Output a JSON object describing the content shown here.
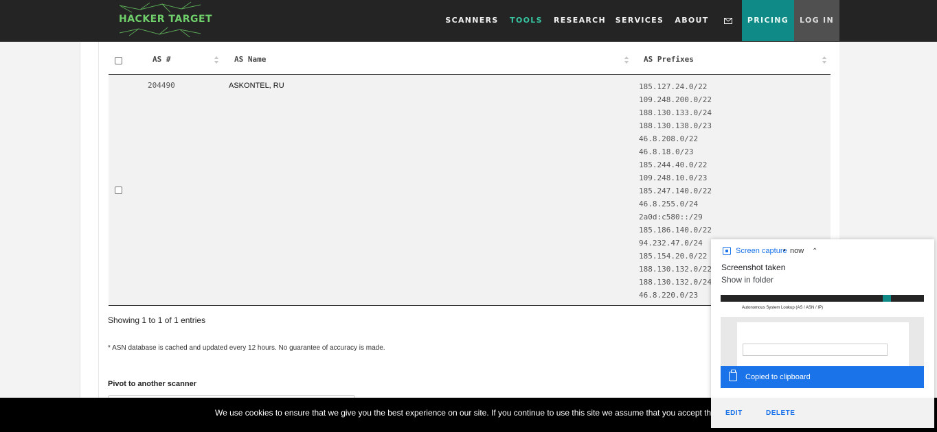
{
  "nav": {
    "logo_text": "HACKER TARGET",
    "items": [
      "SCANNERS",
      "TOOLS",
      "RESEARCH",
      "SERVICES",
      "ABOUT"
    ],
    "active_item": "TOOLS",
    "mail_icon": "mail-icon",
    "pricing": "PRICING",
    "login": "LOG IN",
    "colors": {
      "bar": "#242424",
      "active": "#37c4a0",
      "pricing_bg": "#0f8a86",
      "login_bg": "#505050"
    }
  },
  "table": {
    "headers": [
      "AS #",
      "AS Name",
      "AS Prefixes"
    ],
    "rows": [
      {
        "as_number": "204490",
        "as_name": "ASKONTEL, RU",
        "prefixes": [
          "185.127.24.0/22",
          "109.248.200.0/22",
          "188.130.133.0/24",
          "188.130.138.0/23",
          "46.8.208.0/22",
          "46.8.18.0/23",
          "185.244.40.0/22",
          "109.248.10.0/23",
          "185.247.140.0/22",
          "46.8.255.0/24",
          "2a0d:c580::/29",
          "185.186.140.0/22",
          "94.232.47.0/24",
          "185.154.20.0/22",
          "188.130.132.0/22",
          "188.130.132.0/24",
          "46.8.220.0/23"
        ]
      }
    ],
    "info": "Showing 1 to 1 of 1 entries"
  },
  "note": "* ASN database is cached and updated every 12 hours. No guarantee of accuracy is made.",
  "pivot": {
    "label": "Pivot to another scanner"
  },
  "cookie": {
    "text": "We use cookies to ensure that we give you the best experience on our site. If you continue to use this site we assume that you accept this."
  },
  "notification": {
    "app": "Screen capture",
    "separator": "•",
    "time": "now",
    "title": "Screenshot taken",
    "action": "Show in folder",
    "thumb_title": "Autonomous System Lookup (AS / ASN / IP)",
    "copied": "Copied to clipboard",
    "edit": "EDIT",
    "delete": "DELETE",
    "accent": "#1a73e8"
  }
}
